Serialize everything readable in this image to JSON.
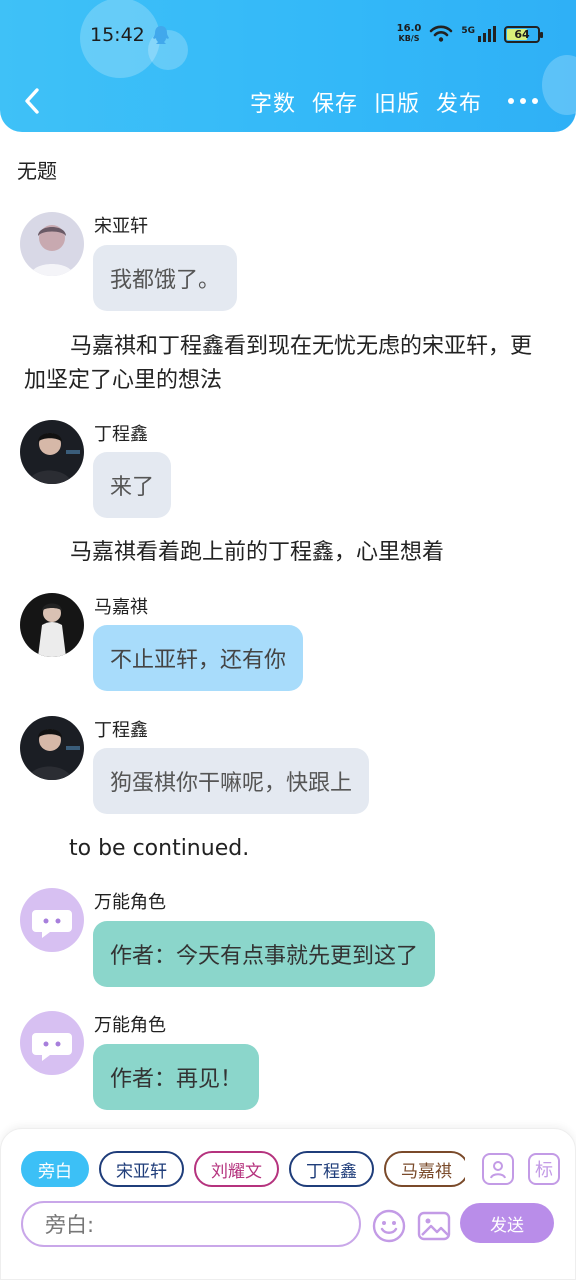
{
  "status": {
    "time": "15:42",
    "net_speed_value": "16.0",
    "net_speed_unit": "KB/S",
    "signal_label": "5G",
    "battery": "64"
  },
  "toolbar": {
    "word_count": "字数",
    "save": "保存",
    "old_version": "旧版",
    "publish": "发布"
  },
  "doc": {
    "title": "无题"
  },
  "messages": [
    {
      "speaker": "宋亚轩",
      "text": "我都饿了。"
    },
    {
      "speaker": "丁程鑫",
      "text": "来了"
    },
    {
      "speaker": "马嘉祺",
      "text": "不止亚轩，还有你"
    },
    {
      "speaker": "丁程鑫",
      "text": "狗蛋棋你干嘛呢，快跟上"
    },
    {
      "speaker": "万能角色",
      "text": "作者：今天有点事就先更到这了"
    },
    {
      "speaker": "万能角色",
      "text": "作者：再见！"
    }
  ],
  "narrations": [
    "马嘉祺和丁程鑫看到现在无忧无虑的宋亚轩，更加坚定了心里的想法",
    "马嘉祺看着跑上前的丁程鑫，心里想着",
    "to be continued."
  ],
  "chips": [
    "旁白",
    "宋亚轩",
    "刘耀文",
    "丁程鑫",
    "马嘉祺"
  ],
  "chip_colors": {
    "active": "#3cc0f6",
    "song": "#1f3d7a",
    "liu": "#b5337e",
    "ding": "#1f3d7a",
    "ma": "#7a4a2a"
  },
  "tool_icons": [
    "person-icon",
    "tag-icon"
  ],
  "tag_icon_glyph": "标",
  "input": {
    "placeholder": "旁白:"
  },
  "send_label": "发送",
  "colors": {
    "header": "#33b8f8",
    "bubble_gray": "#e4e9f1",
    "bubble_blue": "#a8dcfb",
    "bubble_teal": "#8bd6cb",
    "send": "#b98de9"
  }
}
